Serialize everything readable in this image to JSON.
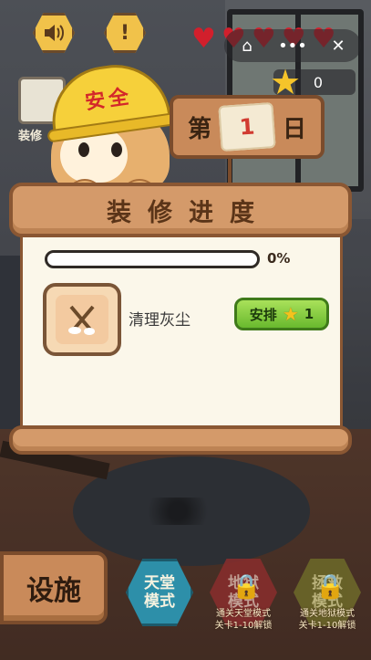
{
  "hud": {
    "sound_icon": "speaker-icon",
    "alert_icon": "exclamation-icon",
    "alert_glyph": "!",
    "hearts": 5,
    "heart_color": "#d21f2c",
    "star_count": "0"
  },
  "mini_program": {
    "home_glyph": "⌂",
    "more_glyph": "•••",
    "close_glyph": "✕"
  },
  "left_menu": {
    "label": "装修"
  },
  "mascot": {
    "helmet_text": "安全"
  },
  "day_sign": {
    "prefix": "第",
    "day": "1",
    "suffix": "日"
  },
  "panel": {
    "title": "装修进度",
    "progress_value": 0,
    "progress_text": "0%",
    "tasks": [
      {
        "name": "清理灰尘",
        "icon": "broom-icon",
        "button_label": "安排",
        "cost": "1"
      }
    ]
  },
  "bottom": {
    "facility_label": "设施",
    "modes": [
      {
        "label": "天堂\n模式",
        "locked": false
      },
      {
        "label": "地狱\n模式",
        "locked": true,
        "note": "通关天堂模式\n关卡1-10解锁"
      },
      {
        "label": "拯救\n模式",
        "locked": true,
        "note": "通关地狱模式\n关卡1-10解锁"
      }
    ]
  },
  "colors": {
    "accent_wood": "#c98a5a",
    "progress_green": "#6cc13a",
    "button_green": "#69b92e",
    "day_number_red": "#d13b31"
  }
}
